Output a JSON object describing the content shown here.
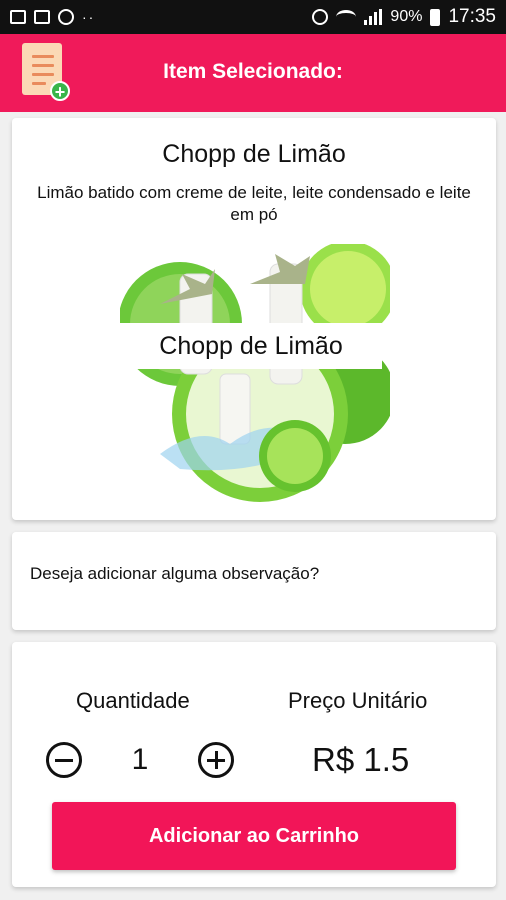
{
  "status_bar": {
    "battery": "90%",
    "time": "17:35",
    "dots": "··"
  },
  "app_bar": {
    "title": "Item Selecionado:"
  },
  "item": {
    "name": "Chopp de Limão",
    "description": "Limão batido com creme de leite, leite condensado e leite em pó",
    "image_label": "Chopp de Limão"
  },
  "note": {
    "prompt": "Deseja adicionar alguma observação?"
  },
  "order": {
    "quantity_label": "Quantidade",
    "price_label": "Preço Unitário",
    "quantity": "1",
    "price": "R$ 1.5",
    "add_to_cart": "Adicionar ao Carrinho"
  },
  "colors": {
    "accent": "#f01a5a",
    "button": "#f21558",
    "lime": "#5cc12a"
  }
}
